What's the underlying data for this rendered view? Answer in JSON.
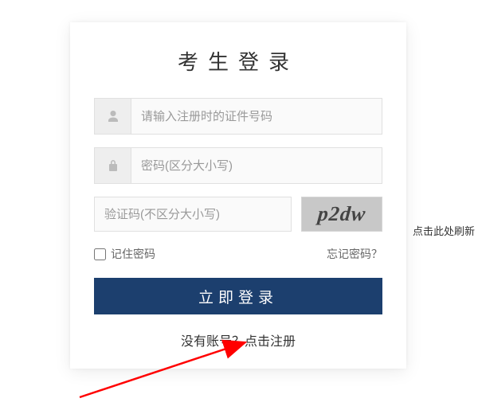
{
  "title": "考生登录",
  "idInput": {
    "placeholder": "请输入注册时的证件号码"
  },
  "passwordInput": {
    "placeholder": "密码(区分大小写)"
  },
  "captchaInput": {
    "placeholder": "验证码(不区分大小写)"
  },
  "captchaText": "p2dw",
  "refreshLabel": "点击此处刷新",
  "rememberLabel": "记住密码",
  "forgotLabel": "忘记密码？",
  "loginButton": "立即登录",
  "registerLabel": "没有账号？点击注册"
}
